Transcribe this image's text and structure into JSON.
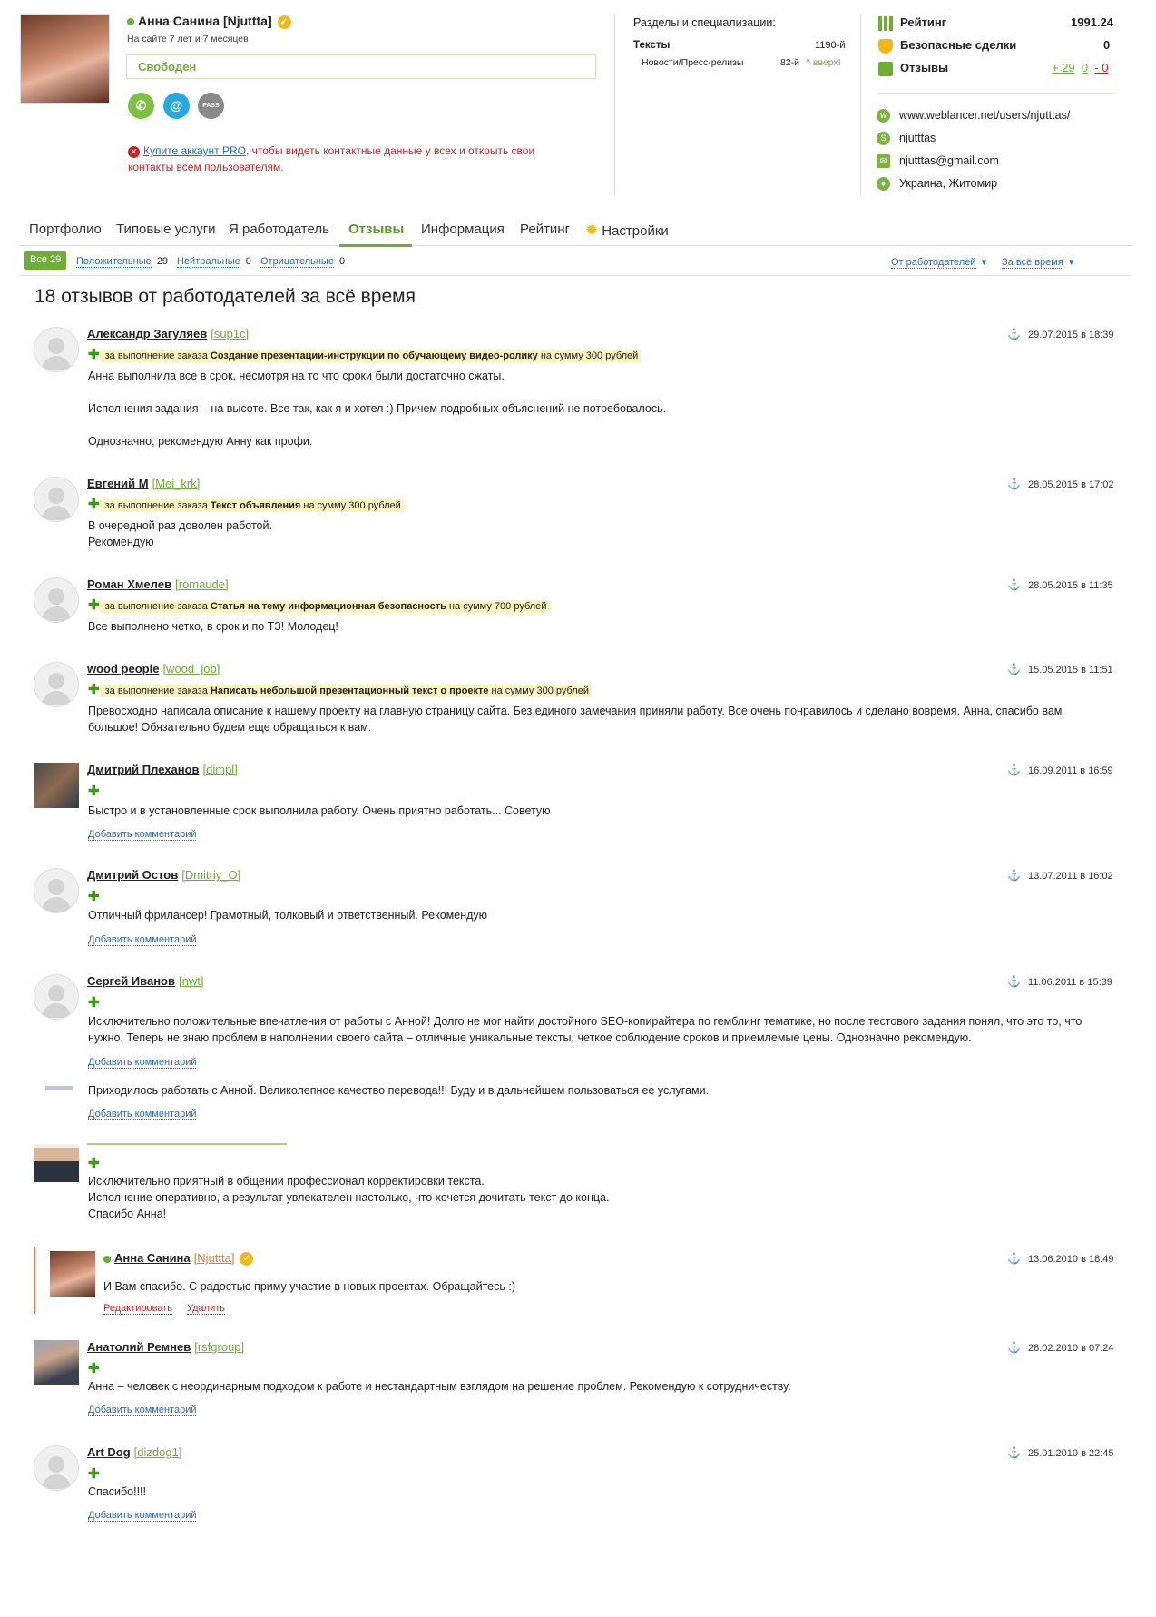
{
  "profile": {
    "name": "Анна Санина [Njuttta]",
    "since": "На сайте 7 лет и 7 месяцев",
    "status": "Свободен",
    "icons": [
      "phone-icon",
      "email-icon",
      "pass-icon"
    ],
    "pass_label": "PASS",
    "pro_link": "Купите аккаунт PRO",
    "pro_text_1": ", чтобы видеть контактные данные у всех и открыть свои",
    "pro_text_2": "контакты всем пользователям."
  },
  "sections": {
    "title": "Разделы и специализации:",
    "main": "Тексты",
    "main_rank": "1190-й",
    "sub": "Новости/Пресс-релизы",
    "sub_rank": "82-й",
    "sub_trend": "вверх!"
  },
  "stats": {
    "rating_label": "Рейтинг",
    "rating_value": "1991.24",
    "safe_label": "Безопасные сделки",
    "safe_value": "0",
    "reviews_label": "Отзывы",
    "pos": "+ 29",
    "neu": "0",
    "neg": "- 0"
  },
  "contacts": [
    {
      "icon": "web-icon",
      "text": "www.weblancer.net/users/njutttas/"
    },
    {
      "icon": "skype-icon",
      "text": "njutttas"
    },
    {
      "icon": "mail-icon",
      "text": "njutttas@gmail.com"
    },
    {
      "icon": "location-icon",
      "text": "Украина, Житомир"
    }
  ],
  "tabs": [
    "Портфолио",
    "Типовые услуги",
    "Я работодатель",
    "Отзывы",
    "Информация",
    "Рейтинг",
    "Настройки"
  ],
  "filters": {
    "all": "Все 29",
    "positive": "Положительные",
    "positive_count": "29",
    "neutral": "Нейтральные",
    "neutral_count": "0",
    "negative": "Отрицательные",
    "negative_count": "0",
    "from": "От работодателей",
    "period": "За всё время"
  },
  "heading": "18 отзывов от работодателей за всё время",
  "order_prefix": "за выполнение заказа",
  "add_comment": "Добавить комментарий",
  "reviews": [
    {
      "name": "Александр Загуляев",
      "login": "[sup1c]",
      "date": "29.07.2015 в 18:39",
      "order": "Создание презентации-инструкции по обучающему видео-ролику",
      "sum": "на сумму 300 рублей",
      "p1": "Анна выполнила все в срок, несмотря на то что сроки были достаточно сжаты.",
      "p2": "Исполнения задания – на высоте. Все так, как я и хотел :) Причем подробных объяснений не потребовалось.",
      "p3": "Однозначно, рекомендую Анну как профи."
    },
    {
      "name": "Евгений М",
      "login": "[Mei_krk]",
      "date": "28.05.2015 в 17:02",
      "order": "Текст объявления",
      "sum": "на сумму 300 рублей",
      "p1": "В очередной раз доволен работой.",
      "p2": "Рекомендую"
    },
    {
      "name": "Роман Хмелев",
      "login": "[romaude]",
      "date": "28.05.2015 в 11:35",
      "order": "Статья на тему информационная безопасность",
      "sum": "на сумму 700 рублей",
      "p1": "Все выполнено четко, в срок и по ТЗ! Молодец!"
    },
    {
      "name": "wood people",
      "login": "[wood_job]",
      "date": "15.05.2015 в 11:51",
      "order": "Написать небольшой презентационный текст о проекте",
      "sum": "на сумму 300 рублей",
      "p1": "Превосходно написала описание к нашему проекту на главную страницу сайта. Без единого замечания приняли работу. Все очень понравилось и сделано вовремя. Анна, спасибо вам",
      "p2": "большое! Обязательно будем еще обращаться к вам."
    },
    {
      "name": "Дмитрий Плеханов",
      "login": "[dimpl]",
      "date": "16.09.2011 в 16:59",
      "p1": "Быстро и в установленные срок выполнила работу. Очень приятно работать... Советую"
    },
    {
      "name": "Дмитрий Остов",
      "login": "[Dmitriy_O]",
      "date": "13.07.2011 в 16:02",
      "p1": "Отличный фрилансер! Грамотный, толковый и ответственный. Рекомендую"
    },
    {
      "name": "Сергей Иванов",
      "login": "[nwt]",
      "date": "11.06.2011 в 15:39",
      "p1": "Исключительно положительные впечатления от работы с Анной! Долго не мог найти достойного SEO-копирайтера по гемблинг тематике, но после тестового задания понял, что это то, что",
      "p2": "нужно. Теперь не знаю проблем в наполнении своего сайта – отличные уникальные тексты, четкое соблюдение сроков и приемлемые цены. Однозначно рекомендую."
    },
    {
      "p1": "Приходилось работать с Анной. Великолепное качество перевода!!! Буду и в дальнейшем пользоваться ее услугами."
    },
    {
      "p1": "Исключительно приятный в общении профессионал корректировки текста.",
      "p2": "Исполнение оперативно, а результат увлекателен настолько, что хочется дочитать текст до конца.",
      "p3": "Спасибо Анна!"
    },
    {
      "name": "Анатолий Ремнев",
      "login": "[rsfgroup]",
      "date": "28.02.2010 в 07:24",
      "p1": "Анна – человек с неординарным подходом к работе и нестандартным взглядом на решение проблем. Рекомендую к сотрудничеству."
    },
    {
      "name": "Art Dog",
      "login": "[dizdog1]",
      "date": "25.01.2010 в 22:45",
      "p1": "Спасибо!!!!"
    }
  ],
  "reply": {
    "name": "Анна Санина",
    "login": "[Njuttta]",
    "date": "13.06.2010 в 18:49",
    "text": "И Вам спасибо. С радостью приму участие в новых проектах. Обращайтесь :)",
    "edit": "Редактировать",
    "delete": "Удалить"
  },
  "colors": {
    "green": "#6fae35",
    "red": "#c0272d",
    "blue": "#2a6db0",
    "orange": "#e07b39"
  }
}
